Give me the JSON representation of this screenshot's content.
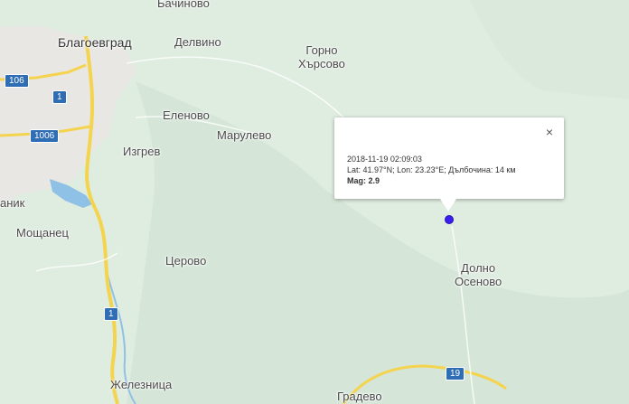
{
  "map": {
    "colors": {
      "land": "#dfece0",
      "urban": "#e9e7e3",
      "highway": "#f4d34f",
      "road": "#ffffff",
      "water": "#8fc0e6",
      "shield": "#2f6db5",
      "marker": "#3a1ef0"
    },
    "places": {
      "bachinovo": "Бачиново",
      "blagoevgrad": "Благоевград",
      "delvino": "Делвино",
      "gorno_harsovo_1": "Горно",
      "gorno_harsovo_2": "Хърсово",
      "elenovo": "Еленово",
      "marulevo": "Марулево",
      "izgrev": "Изгрев",
      "nik": "аник",
      "moshtanets": "Мощанец",
      "tserovo": "Церово",
      "dolno_osenovo_1": "Долно",
      "dolno_osenovo_2": "Осеново",
      "zheleznitsa": "Железница",
      "gradevo": "Градево"
    },
    "road_shields": {
      "r106_top": "106",
      "r1_top": "1",
      "r1006": "1006",
      "r1_bottom": "1",
      "r19": "19"
    }
  },
  "popup": {
    "close_icon": "×",
    "datetime": "2018-11-19 02:09:03",
    "coords": "Lat: 41.97°N; Lon: 23.23°E; Дълбочина: 14 км",
    "mag_label": "Mag:",
    "mag_value": "2.9"
  }
}
